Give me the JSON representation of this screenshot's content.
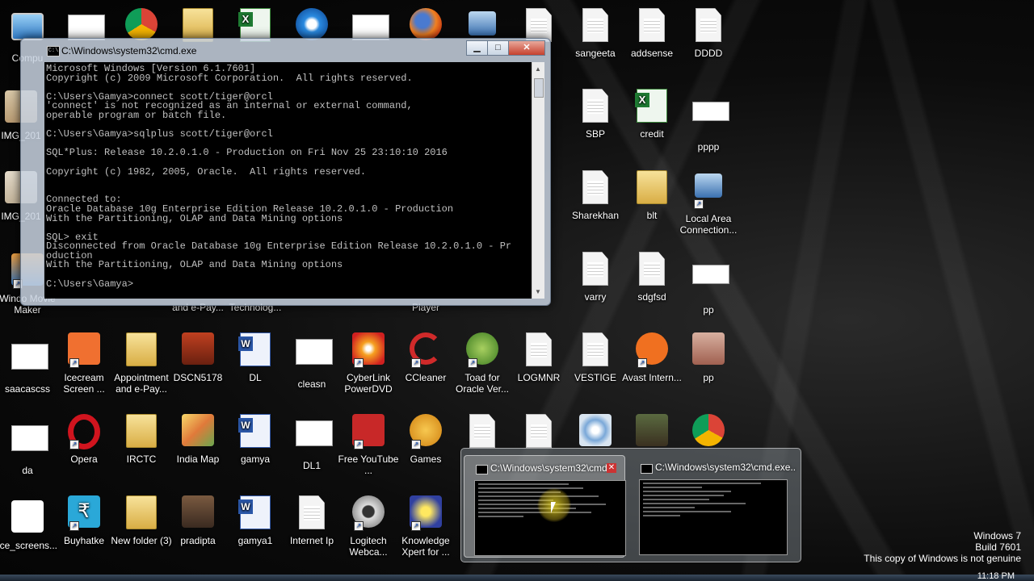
{
  "cmd_window": {
    "title": "C:\\Windows\\system32\\cmd.exe",
    "icon_text": "C:\\",
    "controls": {
      "minimize": "▁",
      "maximize": "□",
      "close": "✕"
    },
    "lines": [
      "Microsoft Windows [Version 6.1.7601]",
      "Copyright (c) 2009 Microsoft Corporation.  All rights reserved.",
      "",
      "C:\\Users\\Gamya>connect scott/tiger@orcl",
      "'connect' is not recognized as an internal or external command,",
      "operable program or batch file.",
      "",
      "C:\\Users\\Gamya>sqlplus scott/tiger@orcl",
      "",
      "SQL*Plus: Release 10.2.0.1.0 - Production on Fri Nov 25 23:10:10 2016",
      "",
      "Copyright (c) 1982, 2005, Oracle.  All rights reserved.",
      "",
      "",
      "Connected to:",
      "Oracle Database 10g Enterprise Edition Release 10.2.0.1.0 - Production",
      "With the Partitioning, OLAP and Data Mining options",
      "",
      "SQL> exit",
      "Disconnected from Oracle Database 10g Enterprise Edition Release 10.2.0.1.0 - Pr",
      "oduction",
      "With the Partitioning, OLAP and Data Mining options",
      "",
      "C:\\Users\\Gamya>"
    ]
  },
  "desktop_icons": [
    {
      "label": "Compu",
      "kind": "computer",
      "shortcut": false
    },
    {
      "label": "IMG_201",
      "kind": "photo",
      "shortcut": false
    },
    {
      "label": "IMG_201",
      "kind": "photo",
      "shortcut": false
    },
    {
      "label": "Windo Movie Maker",
      "kind": "moviemaker",
      "shortcut": true
    },
    {
      "label": "saacascss",
      "kind": "thumb",
      "shortcut": false
    },
    {
      "label": "da",
      "kind": "thumb",
      "shortcut": false
    },
    {
      "label": "ice_screens...",
      "kind": "thumb",
      "shortcut": false
    },
    {
      "label": "Icecream Screen ...",
      "kind": "icecream",
      "shortcut": true
    },
    {
      "label": "Opera",
      "kind": "opera",
      "shortcut": true
    },
    {
      "label": "Buyhatke",
      "kind": "buyhatke",
      "shortcut": true
    },
    {
      "label": "Appointment and e-Pay...",
      "kind": "folder",
      "shortcut": false
    },
    {
      "label": "IRCTC",
      "kind": "folder",
      "shortcut": false
    },
    {
      "label": "New folder (3)",
      "kind": "folder",
      "shortcut": false
    },
    {
      "label": "DSCN5178",
      "kind": "photo",
      "shortcut": false
    },
    {
      "label": "India Map",
      "kind": "photo",
      "shortcut": false
    },
    {
      "label": "pradipta",
      "kind": "photo",
      "shortcut": false
    },
    {
      "label": "DL",
      "kind": "word",
      "shortcut": false
    },
    {
      "label": "gamya",
      "kind": "word",
      "shortcut": false
    },
    {
      "label": "gamya1",
      "kind": "word",
      "shortcut": false
    },
    {
      "label": "cleasn",
      "kind": "thumb",
      "shortcut": false
    },
    {
      "label": "DL1",
      "kind": "thumb",
      "shortcut": false
    },
    {
      "label": "Internet Ip",
      "kind": "doc",
      "shortcut": false
    },
    {
      "label": "CyberLink PowerDVD",
      "kind": "powerdvd",
      "shortcut": true
    },
    {
      "label": "Free YouTube ...",
      "kind": "youtube",
      "shortcut": true
    },
    {
      "label": "Logitech Webca...",
      "kind": "webcam",
      "shortcut": true
    },
    {
      "label": "CCleaner",
      "kind": "ccleaner",
      "shortcut": true
    },
    {
      "label": "Games",
      "kind": "games",
      "shortcut": true
    },
    {
      "label": "Knowledge Xpert for ...",
      "kind": "bulb",
      "shortcut": true
    },
    {
      "label": "Toad for Oracle Ver...",
      "kind": "toad",
      "shortcut": true
    },
    {
      "label": "LOGMNR",
      "kind": "doc",
      "shortcut": false
    },
    {
      "label": "VESTIGE",
      "kind": "doc",
      "shortcut": false
    },
    {
      "label": "Avast Intern...",
      "kind": "avast",
      "shortcut": true
    },
    {
      "label": "pp",
      "kind": "photo",
      "shortcut": false
    },
    {
      "label": "sangeeta",
      "kind": "doc",
      "shortcut": false
    },
    {
      "label": "addsense",
      "kind": "doc",
      "shortcut": false
    },
    {
      "label": "DDDD",
      "kind": "doc",
      "shortcut": false
    },
    {
      "label": "SBP",
      "kind": "doc",
      "shortcut": false
    },
    {
      "label": "credit",
      "kind": "excel",
      "shortcut": false
    },
    {
      "label": "pppp",
      "kind": "thumb",
      "shortcut": false
    },
    {
      "label": "Sharekhan",
      "kind": "doc",
      "shortcut": false
    },
    {
      "label": "blt",
      "kind": "folder",
      "shortcut": false
    },
    {
      "label": "Local Area Connection...",
      "kind": "network",
      "shortcut": true
    },
    {
      "label": "varry",
      "kind": "doc",
      "shortcut": false
    },
    {
      "label": "sdgfsd",
      "kind": "doc",
      "shortcut": false
    },
    {
      "label": "pp",
      "kind": "thumb",
      "shortcut": false
    },
    {
      "label": "and e-Pay...",
      "kind": "hidden",
      "shortcut": false
    },
    {
      "label": "Technolog...",
      "kind": "hidden",
      "shortcut": false
    },
    {
      "label": "Player",
      "kind": "hidden",
      "shortcut": false
    }
  ],
  "taskbar_preview": {
    "items": [
      {
        "title": "C:\\Windows\\system32\\cmd...",
        "close": "✕"
      },
      {
        "title": "C:\\Windows\\system32\\cmd.exe..."
      }
    ]
  },
  "watermark": {
    "line1": "Windows 7",
    "line2": "Build 7601",
    "line3": "This copy of Windows is not genuine"
  },
  "clock": "11:18 PM"
}
